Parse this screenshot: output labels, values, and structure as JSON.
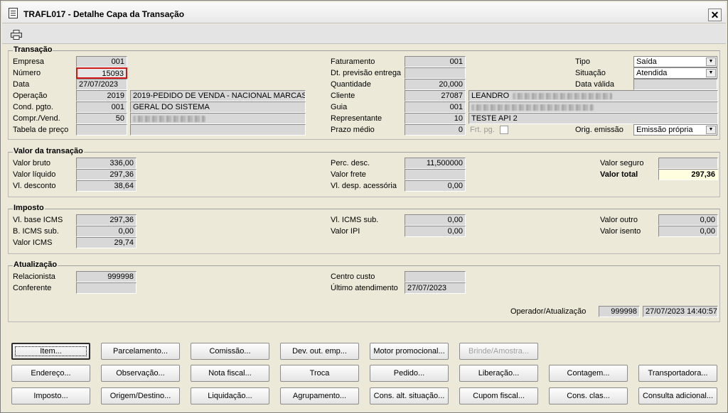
{
  "window": {
    "title": "TRAFL017 - Detalhe Capa da Transação",
    "close_label": "✕"
  },
  "transacao": {
    "group_title": "Transação",
    "labels": {
      "empresa": "Empresa",
      "numero": "Número",
      "data": "Data",
      "operacao": "Operação",
      "cond_pgto": "Cond. pgto.",
      "compr_vend": "Compr./Vend.",
      "tabela_preco": "Tabela de preço",
      "faturamento": "Faturamento",
      "dt_previsao": "Dt. previsão entrega",
      "quantidade": "Quantidade",
      "cliente": "Cliente",
      "guia": "Guia",
      "representante": "Representante",
      "prazo_medio": "Prazo médio",
      "frt_pg": "Frt. pg.",
      "tipo": "Tipo",
      "situacao": "Situação",
      "data_valida": "Data válida",
      "orig_emissao": "Orig. emissão"
    },
    "values": {
      "empresa": "001",
      "numero": "15093",
      "data": "27/07/2023",
      "operacao_code": "2019",
      "operacao_desc": "2019-PEDIDO DE VENDA - NACIONAL MARCAS",
      "cond_pgto_code": "001",
      "cond_pgto_desc": "GERAL DO SISTEMA",
      "compr_vend_code": "50",
      "tabela_preco_code": "",
      "tabela_preco_desc": "",
      "faturamento": "001",
      "dt_previsao": "",
      "quantidade": "20,000",
      "cliente_code": "27087",
      "cliente_name": "LEANDRO",
      "guia_code": "001",
      "representante_code": "10",
      "representante_name": "TESTE API 2",
      "prazo_medio": "0",
      "tipo": "Saída",
      "situacao": "Atendida",
      "data_valida": "",
      "orig_emissao": "Emissão própria"
    }
  },
  "valor": {
    "group_title": "Valor da transação",
    "labels": {
      "valor_bruto": "Valor bruto",
      "valor_liquido": "Valor líquido",
      "vl_desconto": "Vl. desconto",
      "perc_desc": "Perc. desc.",
      "valor_frete": "Valor frete",
      "vl_desp_acessoria": "Vl. desp. acessória",
      "valor_seguro": "Valor seguro",
      "valor_total": "Valor total"
    },
    "values": {
      "valor_bruto": "336,00",
      "valor_liquido": "297,36",
      "vl_desconto": "38,64",
      "perc_desc": "11,500000",
      "valor_frete": "",
      "vl_desp_acessoria": "0,00",
      "valor_seguro": "",
      "valor_total": "297,36"
    }
  },
  "imposto": {
    "group_title": "Imposto",
    "labels": {
      "vl_base_icms": "Vl. base ICMS",
      "b_icms_sub": "B. ICMS sub.",
      "valor_icms": "Valor ICMS",
      "vl_icms_sub": "Vl. ICMS sub.",
      "valor_ipi": "Valor IPI",
      "valor_outro": "Valor outro",
      "valor_isento": "Valor isento"
    },
    "values": {
      "vl_base_icms": "297,36",
      "b_icms_sub": "0,00",
      "valor_icms": "29,74",
      "vl_icms_sub": "0,00",
      "valor_ipi": "0,00",
      "valor_outro": "0,00",
      "valor_isento": "0,00"
    }
  },
  "atualizacao": {
    "group_title": "Atualização",
    "labels": {
      "relacionista": "Relacionista",
      "conferente": "Conferente",
      "centro_custo": "Centro custo",
      "ultimo_atendimento": "Último atendimento",
      "operador_atualizacao": "Operador/Atualização"
    },
    "values": {
      "relacionista": "999998",
      "conferente": "",
      "centro_custo": "",
      "ultimo_atendimento": "27/07/2023",
      "operador": "999998",
      "atualizacao": "27/07/2023 14:40:57"
    }
  },
  "buttons": {
    "row1": [
      "Item...",
      "Parcelamento...",
      "Comissão...",
      "Dev. out. emp...",
      "Motor promocional...",
      "Brinde/Amostra..."
    ],
    "row2": [
      "Endereço...",
      "Observação...",
      "Nota fiscal...",
      "Troca",
      "Pedido...",
      "Liberação...",
      "Contagem...",
      "Transportadora..."
    ],
    "row3": [
      "Imposto...",
      "Origem/Destino...",
      "Liquidação...",
      "Agrupamento...",
      "Cons. alt. situação...",
      "Cupom fiscal...",
      "Cons. clas...",
      "Consulta adicional..."
    ]
  },
  "icons": {
    "document": "document-icon",
    "printer": "printer-icon",
    "close": "close-icon",
    "dropdown": "chevron-down-icon"
  },
  "colors": {
    "window_bg": "#ece9d8",
    "field_bg": "#d8d8d8",
    "highlight_border": "#d01818",
    "total_bg": "#ffffe0"
  }
}
